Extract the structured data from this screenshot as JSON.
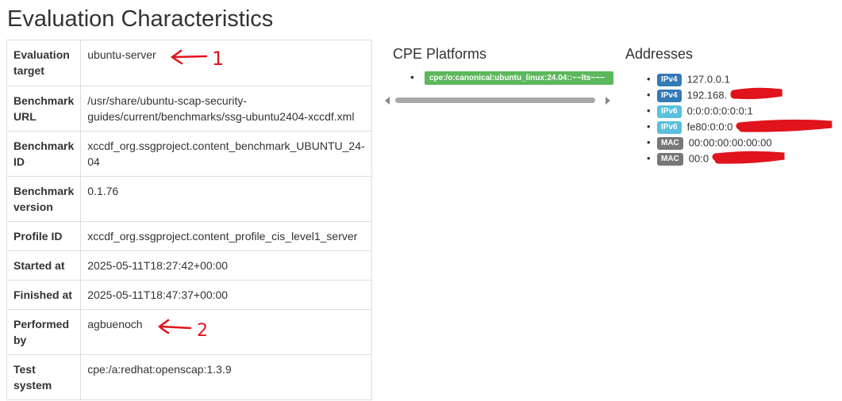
{
  "page": {
    "title": "Evaluation Characteristics"
  },
  "characteristics": [
    {
      "key": "Evaluation target",
      "value": "ubuntu-server"
    },
    {
      "key": "Benchmark URL",
      "value": "/usr/share/ubuntu-scap-security-guides/current/benchmarks/ssg-ubuntu2404-xccdf.xml"
    },
    {
      "key": "Benchmark ID",
      "value": "xccdf_org.ssgproject.content_benchmark_UBUNTU_24-04"
    },
    {
      "key": "Benchmark version",
      "value": "0.1.76"
    },
    {
      "key": "Profile ID",
      "value": "xccdf_org.ssgproject.content_profile_cis_level1_server"
    },
    {
      "key": "Started at",
      "value": "2025-05-11T18:27:42+00:00"
    },
    {
      "key": "Finished at",
      "value": "2025-05-11T18:47:37+00:00"
    },
    {
      "key": "Performed by",
      "value": "agbuenoch"
    },
    {
      "key": "Test system",
      "value": "cpe:/a:redhat:openscap:1.3.9"
    }
  ],
  "annotations": {
    "arrow1_label": "1",
    "arrow2_label": "2"
  },
  "cpe": {
    "title": "CPE Platforms",
    "items": [
      "cpe:/o:canonical:ubuntu_linux:24.04::~~lts~~~"
    ]
  },
  "addresses": {
    "title": "Addresses",
    "items": [
      {
        "type": "IPv4",
        "value": "127.0.0.1",
        "redacted": false
      },
      {
        "type": "IPv4",
        "value": "192.168.",
        "redacted": true
      },
      {
        "type": "IPv6",
        "value": "0:0:0:0:0:0:0:1",
        "redacted": false
      },
      {
        "type": "IPv6",
        "value": "fe80:0:0:0",
        "redacted": true
      },
      {
        "type": "MAC",
        "value": "00:00:00:00:00:00",
        "redacted": false
      },
      {
        "type": "MAC",
        "value": "00:0",
        "redacted": true
      }
    ]
  },
  "colors": {
    "ipv4": "#337ab7",
    "ipv6": "#5bc0de",
    "mac": "#777777",
    "cpe": "#5cb85c",
    "annotation": "#e0141c"
  }
}
